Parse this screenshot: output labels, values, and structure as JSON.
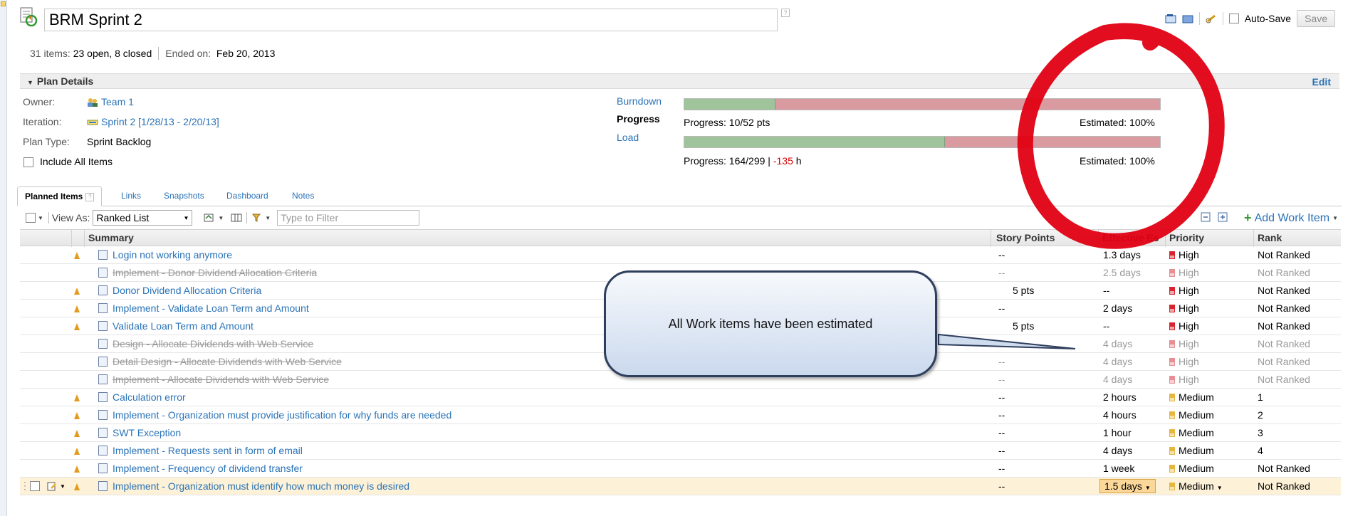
{
  "header": {
    "title": "BRM Sprint 2",
    "autosave_label": "Auto-Save",
    "save_label": "Save"
  },
  "summary": {
    "count": "31 items:",
    "open_closed": "23 open, 8 closed",
    "ended_label": "Ended on:",
    "ended_value": "Feb 20, 2013"
  },
  "plan_details": {
    "heading": "Plan Details",
    "edit_label": "Edit",
    "owner_label": "Owner:",
    "owner_value": "Team 1",
    "iteration_label": "Iteration:",
    "iteration_value": "Sprint 2 [1/28/13 - 2/20/13]",
    "plan_type_label": "Plan Type:",
    "plan_type_value": "Sprint Backlog",
    "include_all_label": "Include All Items"
  },
  "progress": {
    "burndown_label": "Burndown",
    "progress_label": "Progress",
    "load_label": "Load",
    "progress_bar_fraction": 0.192,
    "progress_text": "Progress: 10/52 pts",
    "progress_estimated": "Estimated: 100%",
    "load_bar_fraction": 0.548,
    "load_text_prefix": "Progress: 164/299 |",
    "load_text_negative": "-135",
    "load_text_suffix": "h",
    "load_estimated": "Estimated: 100%",
    "colors": {
      "done": "#9fc49b",
      "remaining": "#d99aa0"
    }
  },
  "tabs": [
    {
      "label": "Planned Items"
    },
    {
      "label": "Links"
    },
    {
      "label": "Snapshots"
    },
    {
      "label": "Dashboard"
    },
    {
      "label": "Notes"
    }
  ],
  "toolbar": {
    "view_as_label": "View As:",
    "view_as_value": "Ranked List",
    "filter_placeholder": "Type to Filter",
    "add_work_item_label": "Add Work Item"
  },
  "table": {
    "headers": {
      "summary": "Summary",
      "story_points": "Story Points",
      "effective_estimate": "Effective Es",
      "priority": "Priority",
      "rank": "Rank"
    },
    "rows": [
      {
        "summary": "Login not working anymore",
        "points": "--",
        "estimate": "1.3 days",
        "priority": "High",
        "rank": "Not Ranked",
        "closed": false,
        "warn": true,
        "prio": "high"
      },
      {
        "summary": "Implement - Donor Dividend Allocation Criteria",
        "points": "--",
        "estimate": "2.5 days",
        "priority": "High",
        "rank": "Not Ranked",
        "closed": true,
        "warn": false,
        "prio": "high"
      },
      {
        "summary": "Donor Dividend Allocation Criteria",
        "points": "5 pts",
        "estimate": "--",
        "priority": "High",
        "rank": "Not Ranked",
        "closed": false,
        "warn": true,
        "prio": "high"
      },
      {
        "summary": "Implement - Validate Loan Term and Amount",
        "points": "--",
        "estimate": "2 days",
        "priority": "High",
        "rank": "Not Ranked",
        "closed": false,
        "warn": true,
        "prio": "high"
      },
      {
        "summary": "Validate Loan Term and Amount",
        "points": "5 pts",
        "estimate": "--",
        "priority": "High",
        "rank": "Not Ranked",
        "closed": false,
        "warn": true,
        "prio": "high"
      },
      {
        "summary": "Design - Allocate Dividends with Web Service",
        "points": "--",
        "estimate": "4 days",
        "priority": "High",
        "rank": "Not Ranked",
        "closed": true,
        "warn": false,
        "prio": "high"
      },
      {
        "summary": "Detail Design - Allocate Dividends with Web Service",
        "points": "--",
        "estimate": "4 days",
        "priority": "High",
        "rank": "Not Ranked",
        "closed": true,
        "warn": false,
        "prio": "high"
      },
      {
        "summary": "Implement - Allocate Dividends with Web Service",
        "points": "--",
        "estimate": "4 days",
        "priority": "High",
        "rank": "Not Ranked",
        "closed": true,
        "warn": false,
        "prio": "high"
      },
      {
        "summary": "Calculation error",
        "points": "--",
        "estimate": "2 hours",
        "priority": "Medium",
        "rank": "1",
        "closed": false,
        "warn": true,
        "prio": "medium"
      },
      {
        "summary": "Implement - Organization must provide justification for why funds are needed",
        "points": "--",
        "estimate": "4 hours",
        "priority": "Medium",
        "rank": "2",
        "closed": false,
        "warn": true,
        "prio": "medium"
      },
      {
        "summary": "SWT Exception",
        "points": "--",
        "estimate": "1 hour",
        "priority": "Medium",
        "rank": "3",
        "closed": false,
        "warn": true,
        "prio": "medium"
      },
      {
        "summary": "Implement - Requests sent in form of email",
        "points": "--",
        "estimate": "4 days",
        "priority": "Medium",
        "rank": "4",
        "closed": false,
        "warn": true,
        "prio": "medium"
      },
      {
        "summary": "Implement - Frequency of dividend transfer",
        "points": "--",
        "estimate": "1 week",
        "priority": "Medium",
        "rank": "Not Ranked",
        "closed": false,
        "warn": true,
        "prio": "medium"
      },
      {
        "summary": "Implement - Organization must identify how much money is desired",
        "points": "--",
        "estimate": "1.5 days",
        "priority": "Medium",
        "rank": "Not Ranked",
        "closed": false,
        "warn": true,
        "prio": "medium",
        "selected": true
      }
    ]
  },
  "annotation": {
    "callout_text": "All Work items have been estimated"
  }
}
